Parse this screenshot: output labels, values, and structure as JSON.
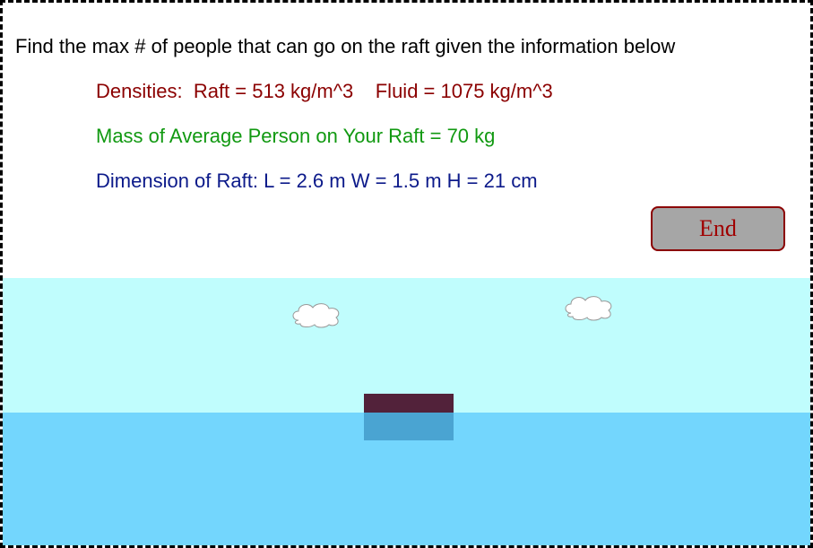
{
  "prompt": {
    "text": "Find the max # of people that can go on the raft given the information below"
  },
  "info": {
    "densities": "Densities:  Raft = 513 kg/m^3    Fluid = 1075 kg/m^3",
    "mass": "Mass of Average Person on Your Raft = 70 kg",
    "dimensions": "Dimension of Raft: L = 2.6 m W = 1.5 m H = 21 cm"
  },
  "end_button": {
    "label": "End"
  },
  "colors": {
    "text_default": "#000000",
    "densities": "#8b0000",
    "mass": "#119911",
    "dimensions": "#0c1a8a",
    "button_bg": "#a6a6a6",
    "button_text": "#a00000",
    "sky": "#c0fdfd",
    "water": "#73d6fd",
    "raft_above": "#52223a",
    "raft_submerged": "#4aa4d2",
    "cloud_fill": "#ffffff",
    "cloud_stroke": "#999999"
  },
  "icons": {
    "cloud_left": "cloud-icon",
    "cloud_right": "cloud-icon"
  }
}
